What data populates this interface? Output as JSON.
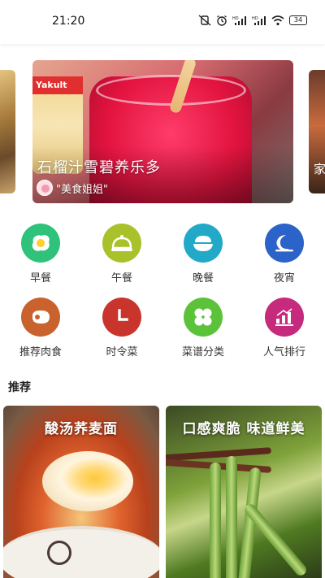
{
  "status_bar": {
    "time": "21:20",
    "battery": "34",
    "icons": [
      "mute-vibrate-icon",
      "alarm-icon",
      "hd-signal-icon",
      "hd-signal-icon",
      "wifi-icon",
      "battery-icon"
    ]
  },
  "carousel": {
    "cards": [
      {
        "title": "",
        "image": "fried-dish-image"
      },
      {
        "title": "石榴汁雪碧养乐多",
        "author": "\"美食姐姐\"",
        "image": "pomegranate-drink-image",
        "bottle_text": "Yakult"
      },
      {
        "title": "家",
        "image": "braised-dish-image"
      }
    ]
  },
  "categories": [
    {
      "label": "早餐",
      "icon": "fried-egg-icon",
      "color": "#2fc27a"
    },
    {
      "label": "午餐",
      "icon": "food-cloche-icon",
      "color": "#a9c12a"
    },
    {
      "label": "晚餐",
      "icon": "rice-bowl-icon",
      "color": "#22a9c7"
    },
    {
      "label": "夜宵",
      "icon": "moon-icon",
      "color": "#2c63c8"
    },
    {
      "label": "推荐肉食",
      "icon": "steak-icon",
      "color": "#c9622c"
    },
    {
      "label": "时令菜",
      "icon": "clock-icon",
      "color": "#c9352c"
    },
    {
      "label": "菜谱分类",
      "icon": "clover-grid-icon",
      "color": "#5cc23a"
    },
    {
      "label": "人气排行",
      "icon": "ranking-chart-icon",
      "color": "#c62a7c"
    }
  ],
  "recommend": {
    "title": "推荐",
    "items": [
      {
        "caption": "酸汤荞麦面",
        "image": "sour-soup-noodles-image"
      },
      {
        "caption": "口感爽脆 味道鲜美",
        "image": "garlic-greens-image"
      }
    ]
  }
}
